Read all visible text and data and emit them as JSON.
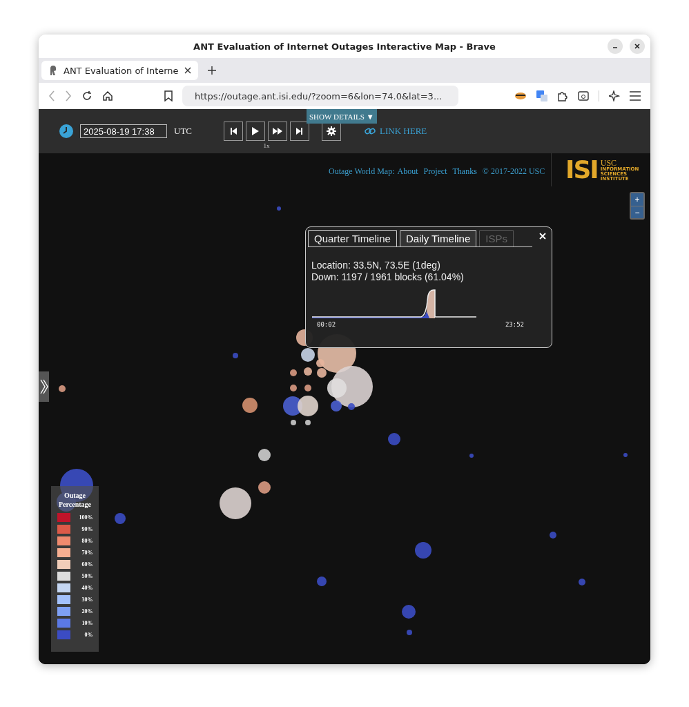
{
  "window": {
    "title": "ANT Evaluation of Internet Outages Interactive Map - Brave"
  },
  "tabs": [
    {
      "label": "ANT Evaluation of Interne",
      "selected": true
    }
  ],
  "address_bar": {
    "url": "https://outage.ant.isi.edu/?zoom=6&lon=74.0&lat=3..."
  },
  "toolbar": {
    "date": "2025-08-19 17:38",
    "timezone": "UTC",
    "speed": "1x",
    "show_details": "SHOW DETAILS ▼",
    "link": "LINK HERE"
  },
  "map": {
    "footer": [
      {
        "kind": "text",
        "label": "Outage World Map:"
      },
      {
        "kind": "link",
        "label": "About"
      },
      {
        "kind": "link",
        "label": "Project"
      },
      {
        "kind": "link",
        "label": "Thanks"
      },
      {
        "kind": "text",
        "label": "© 2017-2022 USC"
      }
    ],
    "logo": {
      "mark": "ISI",
      "lines": [
        "USC",
        "INFORMATION",
        "SCIENCES",
        "INSTITUTE"
      ]
    },
    "zoom": [
      "+",
      "−"
    ]
  },
  "popup": {
    "tabs": [
      {
        "label": "Quarter Timeline",
        "selected": false,
        "disabled": false
      },
      {
        "label": "Daily Timeline",
        "selected": true,
        "disabled": false
      },
      {
        "label": "ISPs",
        "selected": false,
        "disabled": true
      }
    ],
    "location": "Location: 33.5N, 73.5E (1deg)",
    "down": "Down: 1197 / 1961 blocks (61.04%)",
    "time_start": "00:02",
    "time_end": "23:52"
  },
  "legend": {
    "title": "Outage Percentage",
    "items": [
      {
        "label": "100%",
        "color": "#c0142a"
      },
      {
        "label": "90%",
        "color": "#dd5a48"
      },
      {
        "label": "80%",
        "color": "#ef8a6e"
      },
      {
        "label": "70%",
        "color": "#f6ae91"
      },
      {
        "label": "60%",
        "color": "#f1cdb9"
      },
      {
        "label": "50%",
        "color": "#dcdcdc"
      },
      {
        "label": "40%",
        "color": "#c4d6f2"
      },
      {
        "label": "30%",
        "color": "#a3c1fb"
      },
      {
        "label": "20%",
        "color": "#7ea0f4"
      },
      {
        "label": "10%",
        "color": "#5b79e4"
      },
      {
        "label": "0%",
        "color": "#3b4cc3"
      }
    ]
  }
}
